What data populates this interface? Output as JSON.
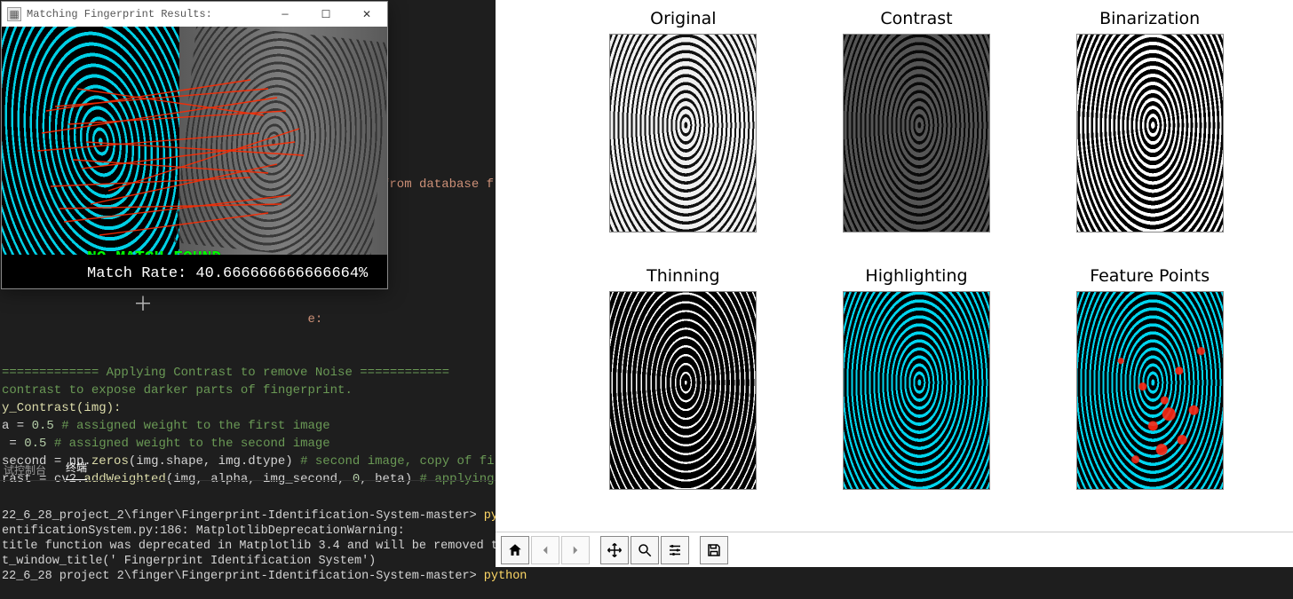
{
  "popup": {
    "title": "Matching Fingerprint Results:",
    "no_match_text": "NO MATCH FOUND.",
    "rate_label": "Match Rate:",
    "rate_value": "40.666666666666664%"
  },
  "code": {
    "frag_database": "from database f",
    "frag_contrast_apply": "e:",
    "section_head": "============= Applying Contrast to remove Noise ============",
    "section_sub": "contrast to expose darker parts of fingerprint.",
    "fn_def": "y_Contrast(img):",
    "line_a": "a = 0.5 ",
    "line_a_com": "# assigned weight to the first image",
    "line_b": " = 0.5 ",
    "line_b_com": "# assigned weight to the second image",
    "line_sec_lhs": "second = np.zeros(img.shape, img.dtype) ",
    "line_sec_com": "# second image, copy of firs",
    "line_rast_lhs": "rast = cv2.addWeighted(img, alpha, img_second, 0, beta) ",
    "line_rast_com": "# applying c"
  },
  "tabs": {
    "debug": "试控制台",
    "terminal": "终端"
  },
  "terminal": {
    "path": "22_6_28_project_2\\finger\\Fingerprint-Identification-System-master> ",
    "cmd": "python",
    "warn_file": "entificationSystem.py:186: MatplotlibDeprecationWarning:",
    "warn_line1": "title function was deprecated in Matplotlib 3.4 and will be removed two m",
    "warn_line2": "t_window_title(' Fingerprint Identification System')",
    "path2": "22_6_28 project 2\\finger\\Fingerprint-Identification-System-master> ",
    "cmd2": "python"
  },
  "subplots": [
    {
      "title": "Original"
    },
    {
      "title": "Contrast"
    },
    {
      "title": "Binarization"
    },
    {
      "title": "Thinning"
    },
    {
      "title": "Highlighting"
    },
    {
      "title": "Feature Points"
    }
  ],
  "toolbar_icons": [
    "home",
    "back",
    "forward",
    "pan",
    "zoom",
    "configure",
    "save"
  ]
}
